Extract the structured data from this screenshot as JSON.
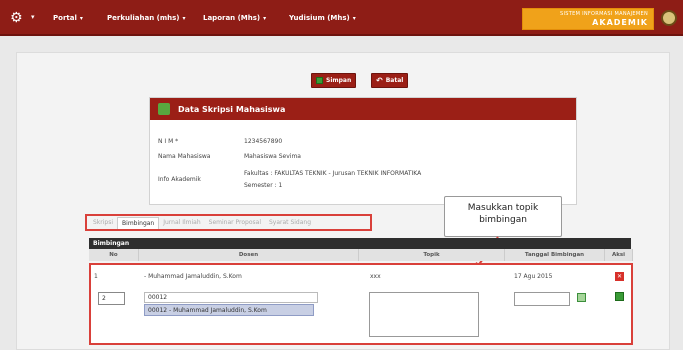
{
  "nav": {
    "items": [
      {
        "label": "Portal",
        "caret": "▾"
      },
      {
        "label": "Perkuliahan (mhs)",
        "caret": "▾"
      },
      {
        "label": "Laporan (Mhs)",
        "caret": "▾"
      },
      {
        "label": "Yudisium (Mhs)",
        "caret": "▾"
      }
    ],
    "brand_line1": "SISTEM INFORMASI MANAJEMEN",
    "brand_line2": "AKADEMIK",
    "gear_glyph": "⚙",
    "caret_glyph": "▾"
  },
  "toolbar": {
    "save_label": "Simpan",
    "back_label": "Batal",
    "back_glyph": "↶"
  },
  "student_panel": {
    "title": "Data Skripsi Mahasiswa",
    "nim_label": "N I M *",
    "nim_value": "1234567890",
    "name_label": "Nama Mahasiswa",
    "name_value": "Mahasiswa Sevima",
    "info_label": "Info Akademik",
    "info_line1": "Fakultas   : FAKULTAS TEKNIK - Jurusan TEKNIK INFORMATIKA",
    "info_line2": "Semester : 1"
  },
  "tabs": [
    "Skripsi",
    "Bimbingan",
    "Jurnal Ilmiah",
    "Seminar Proposal",
    "Syarat Sidang"
  ],
  "callout": {
    "line1": "Masukkan topik",
    "line2": "bimbingan"
  },
  "table": {
    "title": "Bimbingan",
    "headers": {
      "no": "No",
      "dosen": "Dosen",
      "topik": "Topik",
      "tanggal": "Tanggal Bimbingan",
      "aksi": "Aksi"
    },
    "row": {
      "no": "1",
      "dosen": "- Muhammad Jamaluddin, S.Kom",
      "topik": "xxx",
      "tanggal": "17 Agu 2015",
      "delete_glyph": "✕"
    },
    "new_row": {
      "no_value": "2",
      "dosen_value": "00012",
      "suggestion": "00012 - Muhammad Jamaluddin, S.Kom"
    }
  },
  "colors": {
    "primary": "#8e1d16",
    "brand": "#f0a21a",
    "highlight": "#d9403a"
  }
}
